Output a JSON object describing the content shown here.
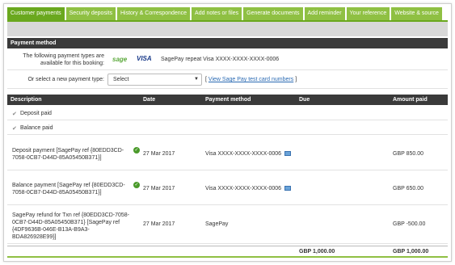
{
  "tabs": [
    {
      "label": "Customer payments",
      "active": true
    },
    {
      "label": "Security deposits"
    },
    {
      "label": "History & Correspondence"
    },
    {
      "label": "Add notes or files"
    },
    {
      "label": "Generate documents"
    },
    {
      "label": "Add reminder"
    },
    {
      "label": "Your reference"
    },
    {
      "label": "Website & source"
    }
  ],
  "payment_method": {
    "heading": "Payment method",
    "types_label": "The following payment types are available for this booking:",
    "logo_sage": "sage",
    "logo_visa": "VISA",
    "repeat_text": "SagePay repeat Visa XXXX-XXXX-XXXX-0006",
    "select_label": "Or select a new payment type:",
    "select_value": "Select",
    "test_link_prefix": "[",
    "test_link_text": "View Sage Pay test card numbers",
    "test_link_suffix": "]"
  },
  "table": {
    "headers": {
      "description": "Description",
      "date": "Date",
      "method": "Payment method",
      "due": "Due",
      "paid": "Amount paid"
    },
    "checks": {
      "deposit": "Deposit paid",
      "balance": "Balance paid"
    },
    "rows": [
      {
        "description": "Deposit payment [SagePay ref {80EDD3CD-7058-0CB7-D44D-85A05450B371}]",
        "date": "27 Mar 2017",
        "method": "Visa XXXX-XXXX-XXXX-0006",
        "due": "",
        "paid": "GBP 850.00"
      },
      {
        "description": "Balance payment [SagePay ref {80EDD3CD-7058-0CB7-D44D-85A05450B371}]",
        "date": "27 Mar 2017",
        "method": "Visa XXXX-XXXX-XXXX-0006",
        "due": "",
        "paid": "GBP 650.00"
      },
      {
        "description": "SagePay refund for Txn ref {80EDD3CD-7058-0CB7-D44D-85A05450B371} [SagePay ref {4DF9636B-046E-B13A-B9A3-BDA826928E99}]",
        "date": "27 Mar 2017",
        "method": "SagePay",
        "due": "",
        "paid": "GBP -500.00"
      }
    ],
    "totals": {
      "due": "GBP 1,000.00",
      "paid": "GBP 1,000.00"
    }
  }
}
